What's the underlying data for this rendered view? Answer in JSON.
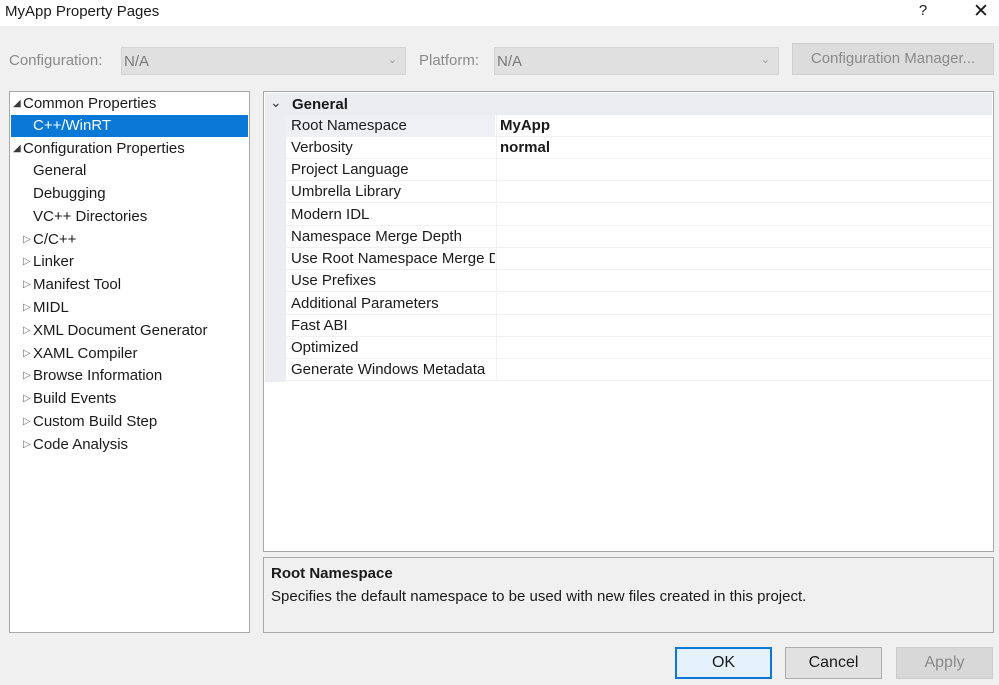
{
  "window": {
    "title": "MyApp Property Pages",
    "help_label": "?",
    "close_label": "✕"
  },
  "toolbar": {
    "configuration_label": "Configuration:",
    "configuration_value": "N/A",
    "platform_label": "Platform:",
    "platform_value": "N/A",
    "configuration_manager_label": "Configuration Manager..."
  },
  "tree": {
    "items": [
      {
        "label": "Common Properties",
        "glyph": "◢",
        "expanded": true
      },
      {
        "label": "C++/WinRT",
        "selected": true
      },
      {
        "label": "Configuration Properties",
        "glyph": "◢",
        "expanded": true
      },
      {
        "label": "General"
      },
      {
        "label": "Debugging"
      },
      {
        "label": "VC++ Directories"
      },
      {
        "label": "C/C++",
        "glyph": "▷"
      },
      {
        "label": "Linker",
        "glyph": "▷"
      },
      {
        "label": "Manifest Tool",
        "glyph": "▷"
      },
      {
        "label": "MIDL",
        "glyph": "▷"
      },
      {
        "label": "XML Document Generator",
        "glyph": "▷"
      },
      {
        "label": "XAML Compiler",
        "glyph": "▷"
      },
      {
        "label": "Browse Information",
        "glyph": "▷"
      },
      {
        "label": "Build Events",
        "glyph": "▷"
      },
      {
        "label": "Custom Build Step",
        "glyph": "▷"
      },
      {
        "label": "Code Analysis",
        "glyph": "▷"
      }
    ]
  },
  "grid": {
    "category": "General",
    "properties": [
      {
        "name": "Root Namespace",
        "value": "MyApp"
      },
      {
        "name": "Verbosity",
        "value": "normal"
      },
      {
        "name": "Project Language",
        "value": ""
      },
      {
        "name": "Umbrella Library",
        "value": ""
      },
      {
        "name": "Modern IDL",
        "value": ""
      },
      {
        "name": "Namespace Merge Depth",
        "value": ""
      },
      {
        "name": "Use Root Namespace Merge Depth",
        "value": ""
      },
      {
        "name": "Use Prefixes",
        "value": ""
      },
      {
        "name": "Additional Parameters",
        "value": ""
      },
      {
        "name": "Fast ABI",
        "value": ""
      },
      {
        "name": "Optimized",
        "value": ""
      },
      {
        "name": "Generate Windows Metadata",
        "value": ""
      }
    ]
  },
  "description": {
    "title": "Root Namespace",
    "text": "Specifies the default namespace to be used with new files created in this project."
  },
  "buttons": {
    "ok": "OK",
    "cancel": "Cancel",
    "apply": "Apply"
  }
}
